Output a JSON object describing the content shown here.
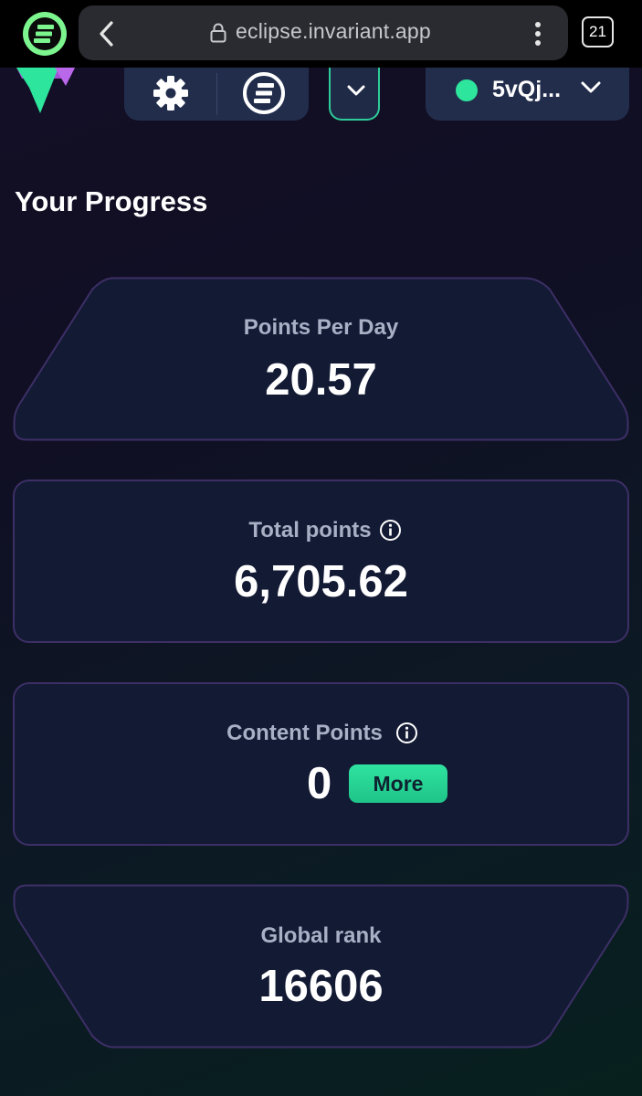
{
  "browser": {
    "url": "eclipse.invariant.app",
    "tab_count": "21"
  },
  "header": {
    "wallet_label": "5vQj...",
    "wallet_status_color": "#2ee59d",
    "accent_color": "#2ecc9a"
  },
  "page": {
    "title": "Your Progress"
  },
  "cards": {
    "points_per_day": {
      "label": "Points Per Day",
      "value": "20.57"
    },
    "total_points": {
      "label": "Total points",
      "value": "6,705.62"
    },
    "content_points": {
      "label": "Content Points",
      "value": "0",
      "more_label": "More"
    },
    "global_rank": {
      "label": "Global rank",
      "value": "16606"
    }
  }
}
